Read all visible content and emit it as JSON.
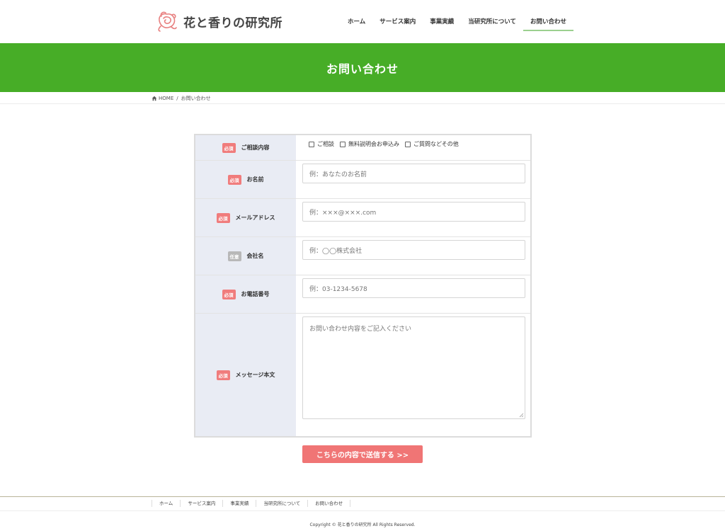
{
  "site": {
    "logo_text": "花と香りの研究所"
  },
  "nav": {
    "items": [
      "ホーム",
      "サービス案内",
      "事業実績",
      "当研究所について",
      "お問い合わせ"
    ],
    "active_index": 4
  },
  "hero": {
    "title": "お問い合わせ"
  },
  "breadcrumb": {
    "home": "HOME",
    "separator": "/",
    "current": "お問い合わせ"
  },
  "form": {
    "consult": {
      "badge": "必須",
      "label": "ご相談内容",
      "options": [
        "ご相談",
        "無料説明会お申込み",
        "ご質問などその他"
      ]
    },
    "name": {
      "badge": "必須",
      "label": "お名前",
      "placeholder": "例：あなたのお名前"
    },
    "email": {
      "badge": "必須",
      "label": "メールアドレス",
      "placeholder": "例：×××@×××.com"
    },
    "company": {
      "badge": "任意",
      "label": "会社名",
      "placeholder": "例：◯◯株式会社"
    },
    "phone": {
      "badge": "必須",
      "label": "お電話番号",
      "placeholder": "例：03-1234-5678"
    },
    "message": {
      "badge": "必須",
      "label": "メッセージ本文",
      "placeholder": "お問い合わせ内容をご記入ください"
    },
    "submit_label": "こちらの内容で送信する >>"
  },
  "footer": {
    "nav": [
      "ホーム",
      "サービス案内",
      "事業実績",
      "当研究所について",
      "お問い合わせ"
    ],
    "copyright": "Copyright © 花と香りの研究所 All Rights Reserved."
  },
  "colors": {
    "brand_green": "#47ad27",
    "required_red": "#f07c7c",
    "optional_gray": "#b8b8b8",
    "submit": "#f07575"
  }
}
